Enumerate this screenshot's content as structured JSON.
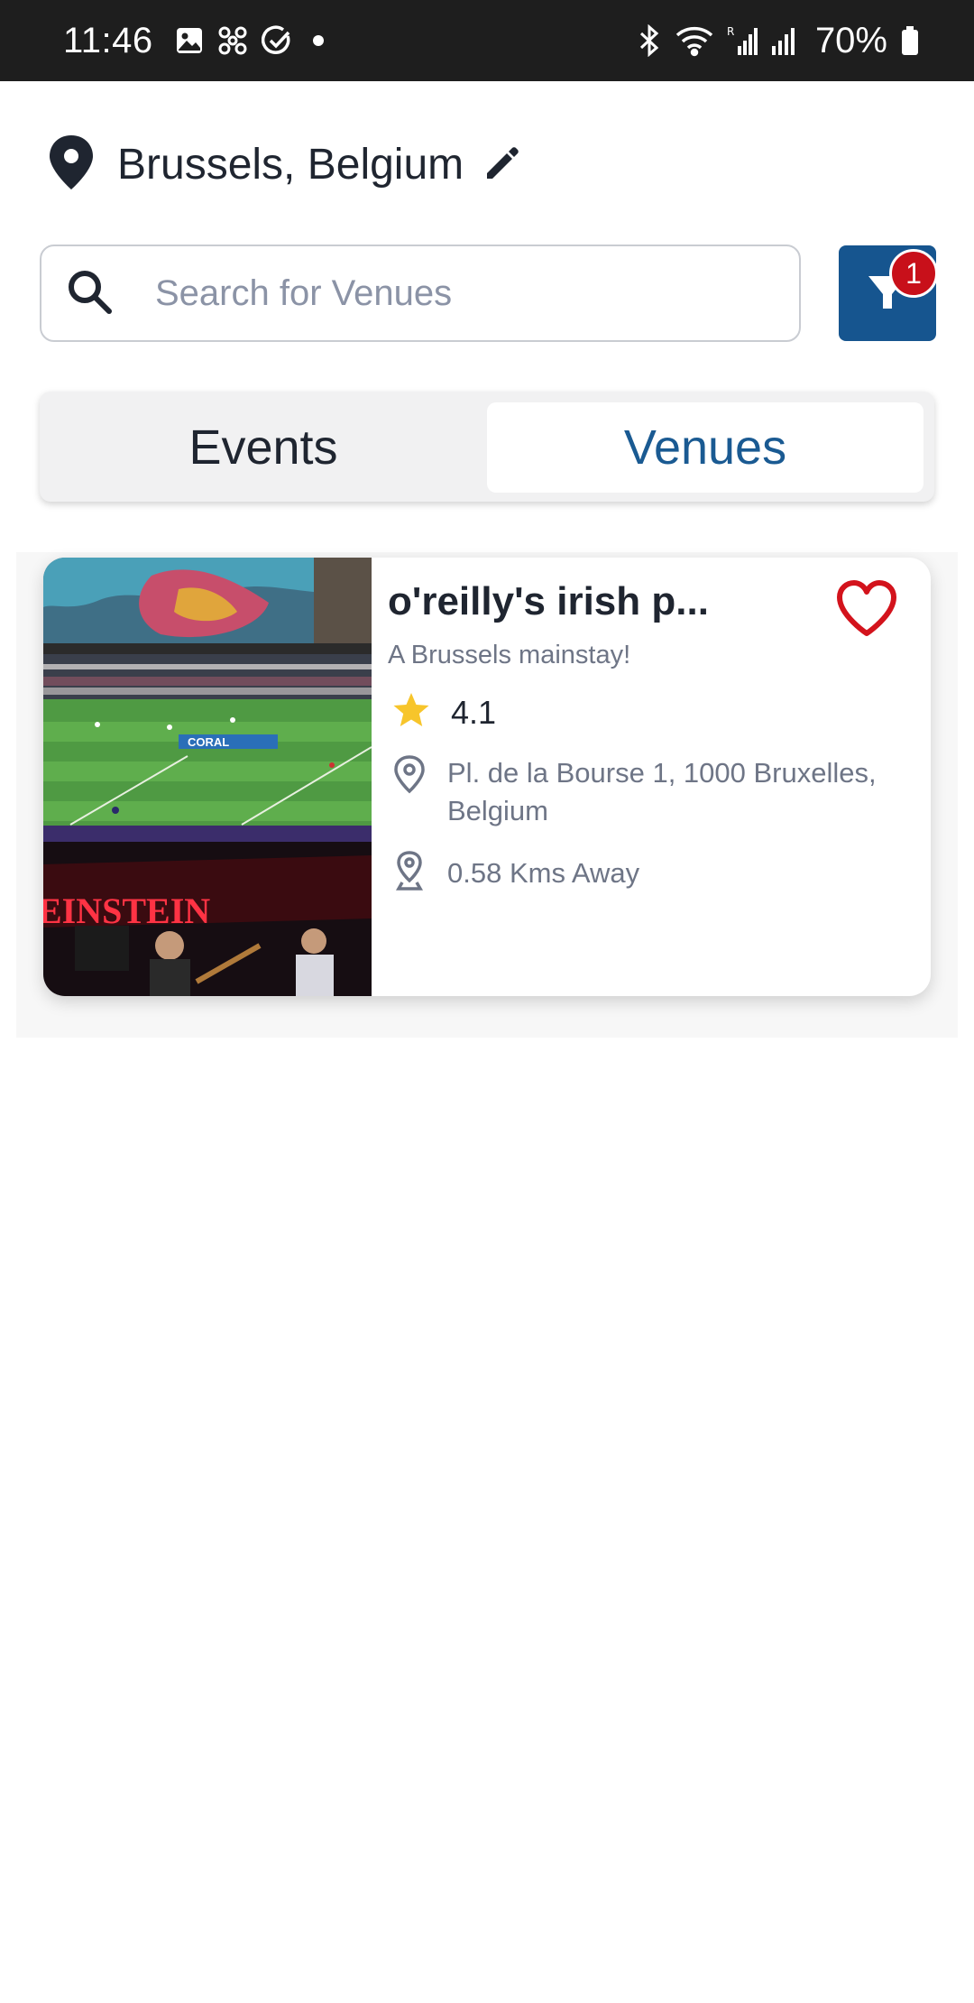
{
  "status_bar": {
    "time": "11:46",
    "battery_percent": "70%",
    "icons_left": [
      "gallery-icon",
      "fan-icon",
      "check-circle-icon",
      "dot-icon"
    ],
    "icons_right": [
      "bluetooth-icon",
      "wifi-icon",
      "signal-roaming-icon",
      "signal-icon",
      "battery-icon"
    ]
  },
  "location": {
    "text": "Brussels, Belgium",
    "icons": [
      "map-pin-icon",
      "pencil-edit-icon"
    ]
  },
  "search": {
    "placeholder": "Search for Venues",
    "value": "",
    "icon": "search-icon"
  },
  "filter": {
    "icon": "filter-icon",
    "badge_count": "1"
  },
  "tabs": {
    "items": [
      "Events",
      "Venues"
    ],
    "active": "Venues"
  },
  "venues": [
    {
      "name": "o'reilly's irish p...",
      "tagline": "A Brussels mainstay!",
      "rating": "4.1",
      "address": "Pl. de la Bourse 1, 1000 Bruxelles, Belgium",
      "distance": "0.58 Kms Away",
      "favorited": true,
      "photo_sign_text": "EINSTEIN",
      "photo_banner_text": "CORAL"
    }
  ],
  "colors": {
    "primary": "#16558f",
    "badge": "#c8101a",
    "heart": "#d3131c",
    "star": "#f7c52b",
    "status_bar": "#1e1e1e"
  }
}
